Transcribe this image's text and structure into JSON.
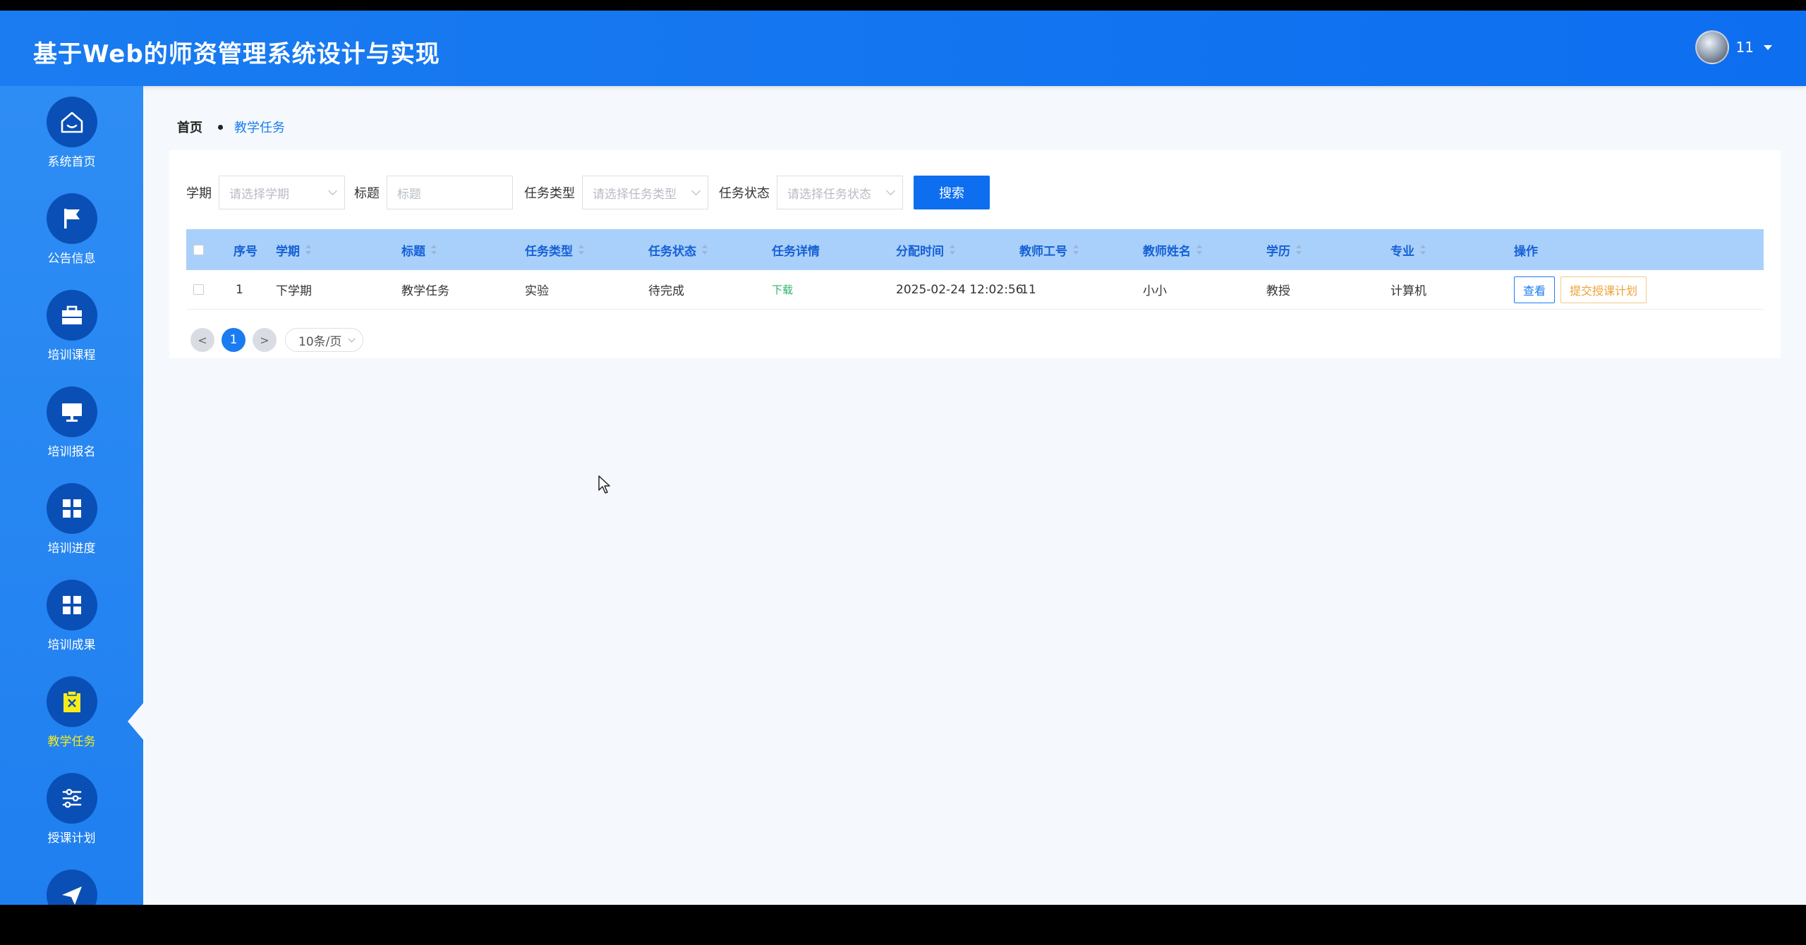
{
  "header": {
    "title": "基于Web的师资管理系统设计与实现",
    "username": "11"
  },
  "sidebar": {
    "items": [
      {
        "label": "系统首页",
        "icon": "home-icon"
      },
      {
        "label": "公告信息",
        "icon": "flag-icon"
      },
      {
        "label": "培训课程",
        "icon": "briefcase-icon"
      },
      {
        "label": "培训报名",
        "icon": "monitor-icon"
      },
      {
        "label": "培训进度",
        "icon": "grid-icon"
      },
      {
        "label": "培训成果",
        "icon": "grid-icon"
      },
      {
        "label": "教学任务",
        "icon": "clipboard-icon",
        "active": true
      },
      {
        "label": "授课计划",
        "icon": "sliders-icon"
      },
      {
        "label": "",
        "icon": "send-icon"
      }
    ],
    "active_color": "#f7ec1a"
  },
  "breadcrumb": {
    "home": "首页",
    "current": "教学任务"
  },
  "filters": {
    "semester_label": "学期",
    "semester_placeholder": "请选择学期",
    "title_label": "标题",
    "title_placeholder": "标题",
    "type_label": "任务类型",
    "type_placeholder": "请选择任务类型",
    "status_label": "任务状态",
    "status_placeholder": "请选择任务状态",
    "search_button": "搜索"
  },
  "table": {
    "columns": [
      "序号",
      "学期",
      "标题",
      "任务类型",
      "任务状态",
      "任务详情",
      "分配时间",
      "教师工号",
      "教师姓名",
      "学历",
      "专业",
      "操作"
    ],
    "rows": [
      {
        "index": "1",
        "semester": "下学期",
        "title": "教学任务",
        "type": "实验",
        "status": "待完成",
        "detail": "下载",
        "assigned_time": "2025-02-24 12:02:56",
        "teacher_id": "11",
        "teacher_name": "小小",
        "education": "教授",
        "major": "计算机",
        "actions": {
          "view": "查看",
          "submit_plan": "提交授课计划"
        }
      }
    ]
  },
  "pagination": {
    "prev": "<",
    "current_page": "1",
    "next": ">",
    "page_size": "10条/页"
  },
  "colors": {
    "primary": "#0d6ef0",
    "table_header": "#a9d0fa",
    "download_link": "#2fb36a",
    "warning": "#eea236"
  }
}
